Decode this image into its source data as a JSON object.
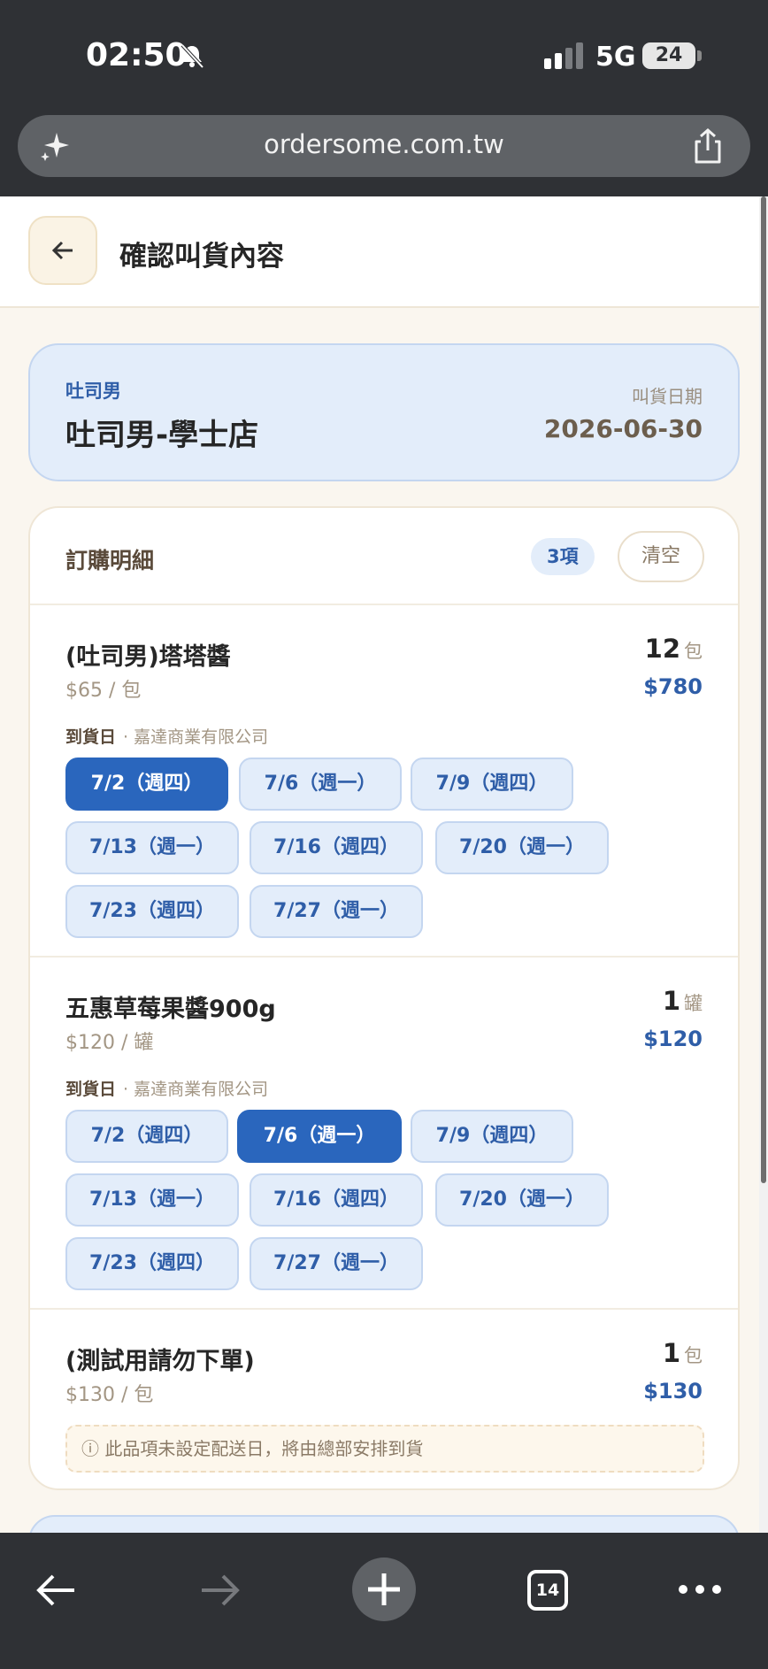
{
  "status_bar": {
    "time": "02:50",
    "network": "5G",
    "battery": "24"
  },
  "browser": {
    "url": "ordersome.com.tw",
    "tab_count": "14"
  },
  "header": {
    "title": "確認叫貨內容"
  },
  "store": {
    "brand": "吐司男",
    "name": "吐司男-學士店",
    "order_date_label": "叫貨日期",
    "order_date": "2026-06-30"
  },
  "order": {
    "title": "訂購明細",
    "count": "3項",
    "clear_label": "清空",
    "items": [
      {
        "name": "(吐司男)塔塔醬",
        "unit_price": "$65 / 包",
        "qty": "12",
        "qty_unit": "包",
        "total": "$780",
        "arrival_label": "到貨日",
        "supplier": "· 嘉達商業有限公司",
        "dates": [
          "7/2（週四）",
          "7/6（週一）",
          "7/9（週四）",
          "7/13（週一）",
          "7/16（週四）",
          "7/20（週一）",
          "7/23（週四）",
          "7/27（週一）"
        ],
        "selected": 0
      },
      {
        "name": "五惠草莓果醬900g",
        "unit_price": "$120 / 罐",
        "qty": "1",
        "qty_unit": "罐",
        "total": "$120",
        "arrival_label": "到貨日",
        "supplier": "· 嘉達商業有限公司",
        "dates": [
          "7/2（週四）",
          "7/6（週一）",
          "7/9（週四）",
          "7/13（週一）",
          "7/16（週四）",
          "7/20（週一）",
          "7/23（週四）",
          "7/27（週一）"
        ],
        "selected": 1
      },
      {
        "name": "(測試用請勿下單)",
        "unit_price": "$130 / 包",
        "qty": "1",
        "qty_unit": "包",
        "total": "$130",
        "notice_icon": "ⓘ",
        "notice": "此品項未設定配送日，將由總部安排到貨"
      }
    ]
  },
  "colors": {
    "accent": "#2a66bd",
    "chip_bg": "#e3edfa",
    "card_bg": "#faf6ef"
  }
}
